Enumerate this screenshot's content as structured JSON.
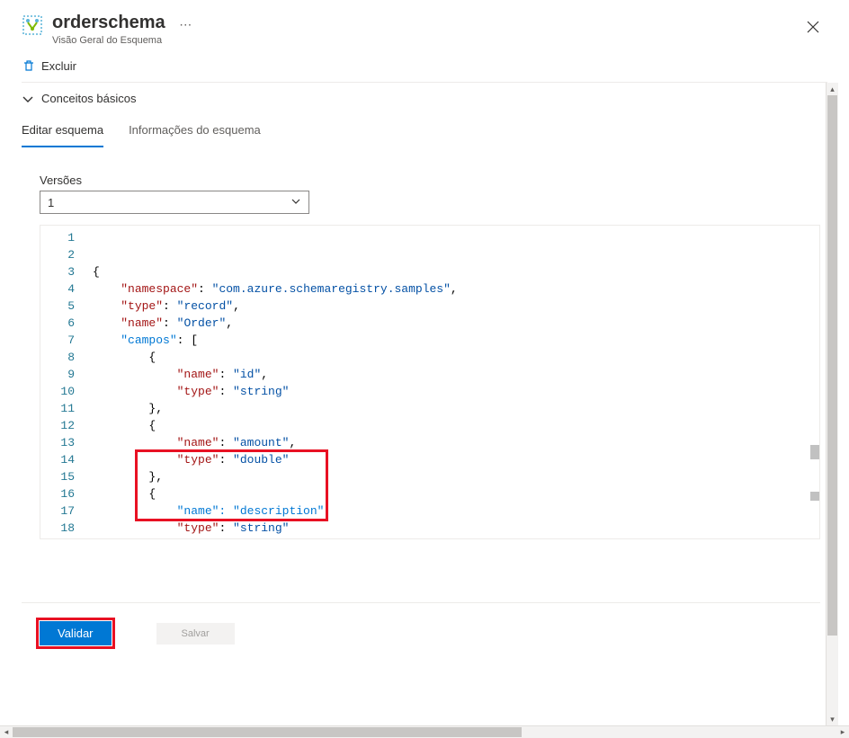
{
  "header": {
    "title": "orderschema",
    "subtitle": "Visão Geral do Esquema"
  },
  "toolbar": {
    "delete_label": "Excluir"
  },
  "essentials": {
    "label": "Conceitos básicos"
  },
  "tabs": {
    "edit": "Editar esquema",
    "info": "Informações do esquema"
  },
  "versions": {
    "label": "Versões",
    "selected": "1"
  },
  "editor": {
    "line_count": 18,
    "lines": [
      [
        {
          "t": "{",
          "c": "punc"
        }
      ],
      [
        {
          "t": "    ",
          "c": "punc"
        },
        {
          "t": "\"namespace\"",
          "c": "key"
        },
        {
          "t": ": ",
          "c": "punc"
        },
        {
          "t": "\"com.azure.schemaregistry.samples\"",
          "c": "str"
        },
        {
          "t": ",",
          "c": "punc"
        }
      ],
      [
        {
          "t": "    ",
          "c": "punc"
        },
        {
          "t": "\"type\"",
          "c": "key"
        },
        {
          "t": ": ",
          "c": "punc"
        },
        {
          "t": "\"record\"",
          "c": "str"
        },
        {
          "t": ",",
          "c": "punc"
        }
      ],
      [
        {
          "t": "    ",
          "c": "punc"
        },
        {
          "t": "\"name\"",
          "c": "key"
        },
        {
          "t": ": ",
          "c": "punc"
        },
        {
          "t": "\"Order\"",
          "c": "str"
        },
        {
          "t": ",",
          "c": "punc"
        }
      ],
      [
        {
          "t": "    ",
          "c": "punc"
        },
        {
          "t": "\"campos\"",
          "c": "highlight"
        },
        {
          "t": ": [",
          "c": "punc"
        }
      ],
      [
        {
          "t": "        {",
          "c": "punc"
        }
      ],
      [
        {
          "t": "            ",
          "c": "punc"
        },
        {
          "t": "\"name\"",
          "c": "key"
        },
        {
          "t": ": ",
          "c": "punc"
        },
        {
          "t": "\"id\"",
          "c": "str"
        },
        {
          "t": ",",
          "c": "punc"
        }
      ],
      [
        {
          "t": "            ",
          "c": "punc"
        },
        {
          "t": "\"type\"",
          "c": "key"
        },
        {
          "t": ": ",
          "c": "punc"
        },
        {
          "t": "\"string\"",
          "c": "str"
        }
      ],
      [
        {
          "t": "        },",
          "c": "punc"
        }
      ],
      [
        {
          "t": "        {",
          "c": "punc"
        }
      ],
      [
        {
          "t": "            ",
          "c": "punc"
        },
        {
          "t": "\"name\"",
          "c": "key"
        },
        {
          "t": ": ",
          "c": "punc"
        },
        {
          "t": "\"amount\"",
          "c": "str"
        },
        {
          "t": ",",
          "c": "punc"
        }
      ],
      [
        {
          "t": "            ",
          "c": "punc"
        },
        {
          "t": "\"type\"",
          "c": "key"
        },
        {
          "t": ": ",
          "c": "punc"
        },
        {
          "t": "\"double\"",
          "c": "str"
        }
      ],
      [
        {
          "t": "        },",
          "c": "punc"
        }
      ],
      [
        {
          "t": "        {",
          "c": "punc"
        }
      ],
      [
        {
          "t": "            ",
          "c": "punc"
        },
        {
          "t": "\"name\": \"description\"",
          "c": "highlight"
        },
        {
          "t": ",",
          "c": "punc"
        }
      ],
      [
        {
          "t": "            ",
          "c": "punc"
        },
        {
          "t": "\"type\"",
          "c": "key"
        },
        {
          "t": ": ",
          "c": "punc"
        },
        {
          "t": "\"string\"",
          "c": "str"
        }
      ],
      [
        {
          "t": "        }",
          "c": "punc"
        }
      ],
      [
        {
          "t": "    ]",
          "c": "punc"
        }
      ]
    ]
  },
  "footer": {
    "validate_label": "Validar",
    "save_label": "Salvar"
  }
}
